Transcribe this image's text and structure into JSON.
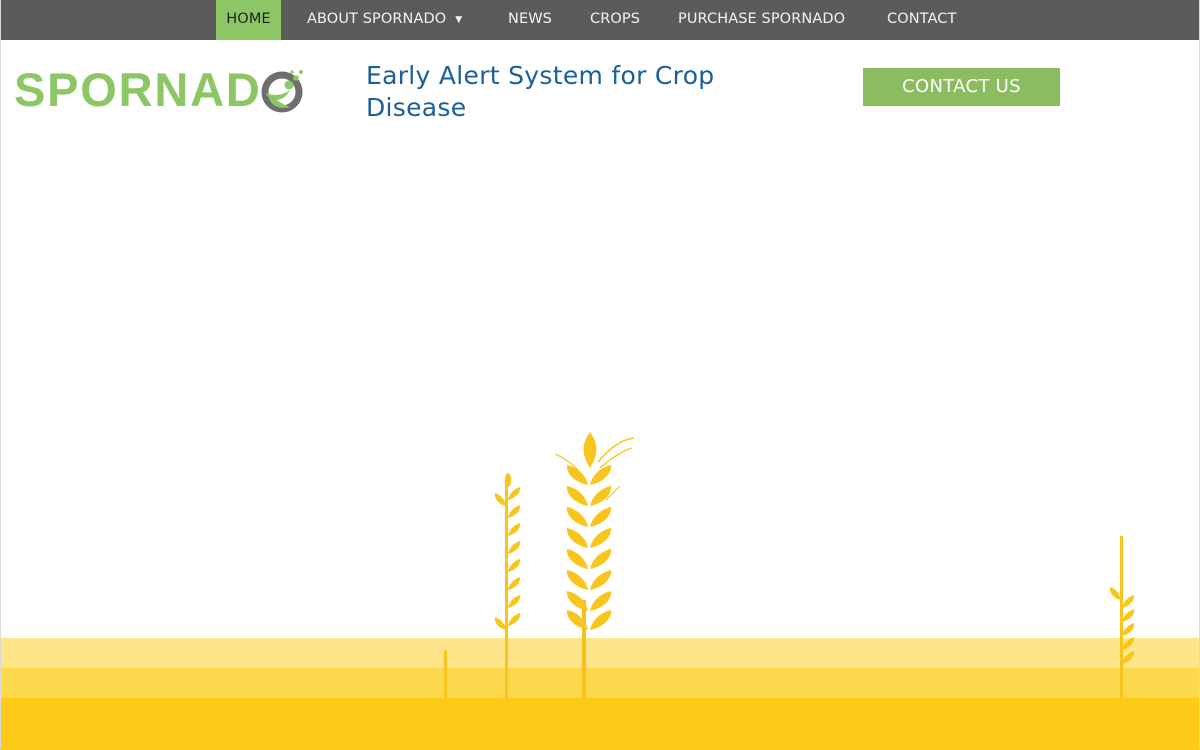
{
  "nav": {
    "items": [
      {
        "label": "HOME",
        "active": true
      },
      {
        "label": "ABOUT SPORNADO",
        "has_dropdown": true
      },
      {
        "label": "NEWS"
      },
      {
        "label": "CROPS"
      },
      {
        "label": "PURCHASE SPORNADO"
      },
      {
        "label": "CONTACT"
      }
    ],
    "dropdown_caret": "▼"
  },
  "header": {
    "logo_text": "SPORNAD",
    "logo_icon": "spore-o-icon",
    "tagline": "Early Alert System for Crop Disease",
    "contact_button": "CONTACT US"
  },
  "colors": {
    "nav_bg": "#5b5b5b",
    "nav_active_bg": "#8cc665",
    "brand_green": "#8cc665",
    "tagline_blue": "#1a5e9a",
    "button_green": "#8cbc60",
    "wheat_gold": "#f8c51c",
    "ground_light": "#fee58a",
    "ground_mid": "#fdd94e",
    "ground_dark": "#fcca17"
  },
  "hero": {
    "illustration": "wheat-field-illustration"
  }
}
